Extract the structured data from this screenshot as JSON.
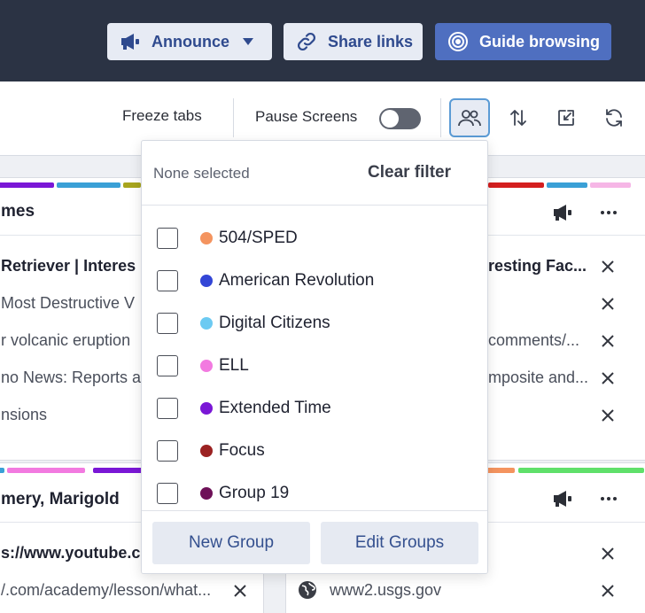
{
  "topbar": {
    "announce_label": "Announce",
    "share_label": "Share links",
    "guide_label": "Guide browsing"
  },
  "toolbar": {
    "freeze_label": "Freeze tabs",
    "pause_label": "Pause Screens",
    "pause_on": false
  },
  "cards": {
    "left_top": {
      "title": "mes",
      "rows": [
        "Retriever | Interes",
        "Most Destructive V",
        "r volcanic eruption",
        "no News: Reports a",
        "nsions"
      ]
    },
    "right_top": {
      "rows": [
        "resting Fac...",
        "comments/...",
        "mposite and..."
      ]
    },
    "left_bottom": {
      "title": "mery, Marigold",
      "rows": [
        "s://www.youtube.c",
        "/.com/academy/lesson/what..."
      ]
    },
    "right_bottom": {
      "rows": [
        "www2.usgs.gov"
      ]
    }
  },
  "filter_dropdown": {
    "status": "None selected",
    "clear_label": "Clear filter",
    "groups": [
      {
        "name": "504/SPED",
        "color": "#f4945f"
      },
      {
        "name": "American Revolution",
        "color": "#3346d6"
      },
      {
        "name": "Digital Citizens",
        "color": "#6ccaf2"
      },
      {
        "name": "ELL",
        "color": "#f27ae0"
      },
      {
        "name": "Extended Time",
        "color": "#7a17d6"
      },
      {
        "name": "Focus",
        "color": "#9b2222"
      },
      {
        "name": "Group 19",
        "color": "#6e1158"
      }
    ],
    "new_group_label": "New Group",
    "edit_groups_label": "Edit Groups"
  }
}
